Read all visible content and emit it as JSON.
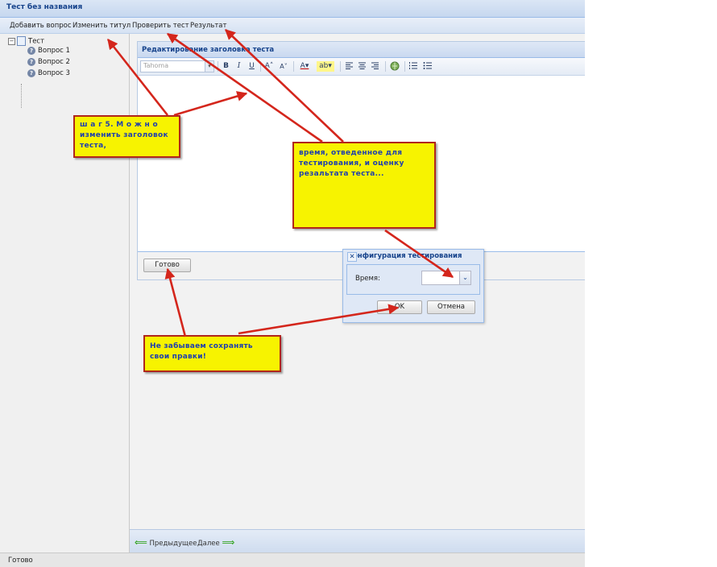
{
  "window": {
    "title": "Тест без названия"
  },
  "menu": {
    "items": [
      {
        "label": "Добавить вопрос"
      },
      {
        "label": "Изменить титул"
      },
      {
        "label": "Проверить тест"
      },
      {
        "label": "Результат"
      }
    ]
  },
  "tree": {
    "root": {
      "label": "Тест",
      "toggle": "−"
    },
    "children": [
      {
        "label": "Вопрос 1"
      },
      {
        "label": "Вопрос 2"
      },
      {
        "label": "Вопрос 3"
      }
    ]
  },
  "editor_panel": {
    "title": "Редактирование заголовка теста",
    "font_select": {
      "value": "Tahoma"
    },
    "toolbar": {
      "bold": "B",
      "italic": "I",
      "underline": "U",
      "grow_font": "A˄",
      "shrink_font": "A˅",
      "font_color": "A▾",
      "highlight": "ab▾"
    },
    "done_button": "Готово"
  },
  "dialog": {
    "title": "Конфигурация тестирования",
    "close": "✕",
    "time_label": "Время:",
    "time_value": "",
    "ok_button": "OK",
    "cancel_button": "Отмена"
  },
  "nav": {
    "prev_label": "Предыдущее",
    "next_label": "Далее"
  },
  "status": {
    "text": "Готово"
  },
  "callouts": {
    "step5": "ш а г  5.  М о ж н о изменить заголовок теста,",
    "time": "время, отведенное для тестирования, и оценку резальтата теста...",
    "save": "Не забываем сохранять свои правки!"
  },
  "colors": {
    "callout_bg": "#f7f300",
    "callout_border": "#b0261c",
    "arrow": "#d4261c",
    "callout_text": "#1f3fae"
  }
}
